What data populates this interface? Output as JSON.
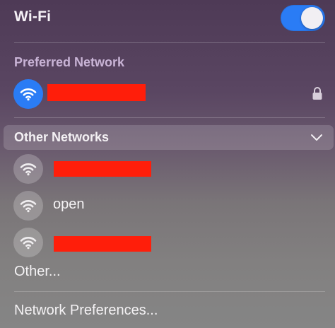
{
  "wifi": {
    "title": "Wi-Fi",
    "enabled": true
  },
  "preferred": {
    "section_label": "Preferred Network",
    "network": {
      "name_redacted": true,
      "icon": "wifi-icon",
      "connected": true,
      "secured_icon": "lock-icon"
    }
  },
  "other": {
    "section_label": "Other Networks",
    "expand_icon": "chevron-down-icon",
    "networks": [
      {
        "name_redacted": true,
        "icon": "wifi-icon"
      },
      {
        "name": "open",
        "icon": "wifi-icon"
      },
      {
        "name_redacted": true,
        "icon": "wifi-icon"
      }
    ]
  },
  "menu": {
    "other_label": "Other...",
    "network_prefs_label": "Network Preferences..."
  },
  "colors": {
    "accent": "#2a7cf5",
    "redaction": "#ff1e0a",
    "section_title": "#c9b4d6"
  }
}
